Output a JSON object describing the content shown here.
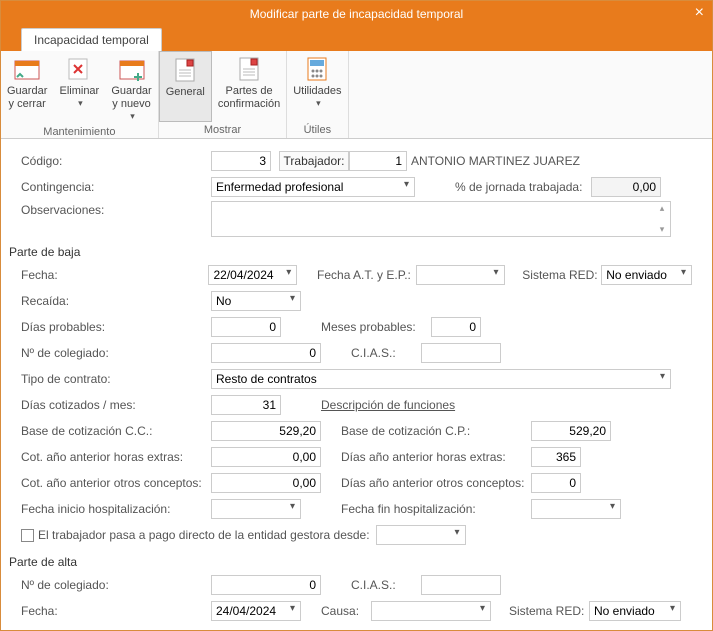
{
  "window": {
    "title": "Modificar parte de incapacidad temporal"
  },
  "tabs": {
    "main": "Incapacidad temporal"
  },
  "ribbon": {
    "maintenance_label": "Mantenimiento",
    "show_label": "Mostrar",
    "utils_label": "Útiles",
    "save_close": "Guardar\ny cerrar",
    "delete": "Eliminar",
    "save_new": "Guardar\ny nuevo",
    "general": "General",
    "confirm_parts": "Partes de\nconfirmación",
    "utilities": "Utilidades"
  },
  "labels": {
    "codigo": "Código:",
    "trabajador": "Trabajador:",
    "contingencia": "Contingencia:",
    "pct_jornada": "% de jornada trabajada:",
    "observaciones": "Observaciones:",
    "parte_baja": "Parte de baja",
    "fecha": "Fecha:",
    "fecha_at_ep": "Fecha A.T. y E.P.:",
    "sistema_red": "Sistema RED:",
    "recaida": "Recaída:",
    "dias_probables": "Días probables:",
    "meses_probables": "Meses probables:",
    "n_colegiado": "Nº de colegiado:",
    "cias": "C.I.A.S.:",
    "tipo_contrato": "Tipo de contrato:",
    "dias_cotizados_mes": "Días cotizados / mes:",
    "descripcion_funciones": "Descripción de funciones",
    "base_cot_cc": "Base de cotización C.C.:",
    "base_cot_cp": "Base de cotización C.P.:",
    "cot_ano_ant_horas_extras": "Cot. año anterior horas extras:",
    "dias_ano_ant_horas_extras": "Días año anterior horas extras:",
    "cot_ano_ant_otros": "Cot. año anterior otros conceptos:",
    "dias_ano_ant_otros": "Días año anterior otros conceptos:",
    "fecha_inicio_hosp": "Fecha inicio hospitalización:",
    "fecha_fin_hosp": "Fecha fin hospitalización:",
    "pago_directo": "El trabajador pasa a pago directo de la entidad gestora desde:",
    "parte_alta": "Parte de alta",
    "causa": "Causa:"
  },
  "values": {
    "codigo": "3",
    "trabajador_num": "1",
    "trabajador_nombre": "ANTONIO MARTINEZ JUAREZ",
    "contingencia": "Enfermedad profesional",
    "pct_jornada": "0,00",
    "observaciones": "",
    "baja_fecha": "22/04/2024",
    "baja_fecha_at_ep": "",
    "baja_sistema_red": "No enviado",
    "recaida": "No",
    "dias_probables": "0",
    "meses_probables": "0",
    "n_colegiado_baja": "0",
    "cias_baja": "",
    "tipo_contrato": "Resto de contratos",
    "dias_cotizados_mes": "31",
    "base_cot_cc": "529,20",
    "base_cot_cp": "529,20",
    "cot_ano_ant_horas_extras": "0,00",
    "dias_ano_ant_horas_extras": "365",
    "cot_ano_ant_otros": "0,00",
    "dias_ano_ant_otros": "0",
    "fecha_inicio_hosp": "",
    "fecha_fin_hosp": "",
    "pago_directo_fecha": "",
    "n_colegiado_alta": "0",
    "cias_alta": "",
    "alta_fecha": "24/04/2024",
    "causa": "",
    "alta_sistema_red": "No enviado"
  }
}
